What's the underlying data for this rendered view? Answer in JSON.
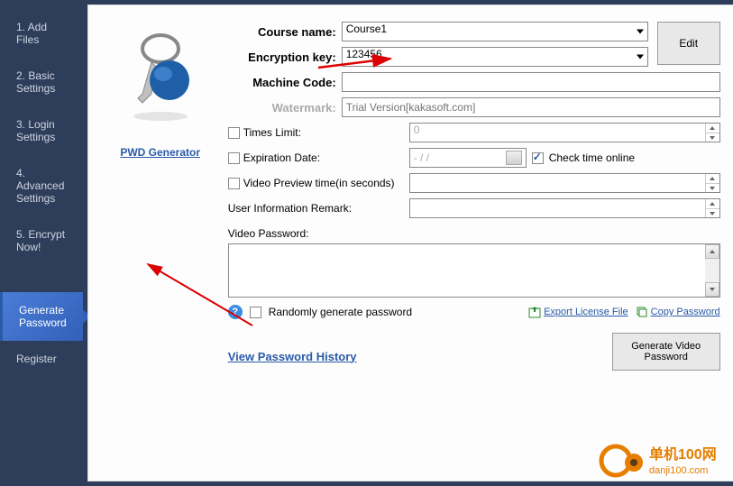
{
  "sidebar": {
    "items": [
      {
        "label": "1. Add Files"
      },
      {
        "label": "2. Basic Settings"
      },
      {
        "label": "3. Login Settings"
      },
      {
        "label": "4. Advanced Settings"
      },
      {
        "label": "5. Encrypt Now!"
      },
      {
        "label": "Generate Password"
      },
      {
        "label": "Register"
      }
    ]
  },
  "pwd_gen_link": "PWD Generator",
  "form": {
    "course_name_label": "Course name:",
    "course_name_value": "Course1",
    "encryption_key_label": "Encryption key:",
    "encryption_key_value": "123456",
    "machine_code_label": "Machine Code:",
    "machine_code_value": "",
    "watermark_label": "Watermark:",
    "watermark_placeholder": "Trial Version[kakasoft.com]",
    "edit_btn": "Edit",
    "times_limit_label": "Times Limit:",
    "times_limit_value": "0",
    "expiration_date_label": "Expiration Date:",
    "expiration_date_value": "- / /",
    "check_time_label": "Check time online",
    "video_preview_label": "Video Preview time(in seconds)",
    "user_info_label": "User Information Remark:",
    "video_password_label": "Video Password:",
    "randomly_label": "Randomly generate password",
    "export_license_label": "Export License File",
    "copy_password_label": "Copy Password",
    "history_link": "View Password History",
    "generate_btn": "Generate Video Password"
  },
  "watermark_brand": "单机100网",
  "watermark_url": "danji100.com"
}
